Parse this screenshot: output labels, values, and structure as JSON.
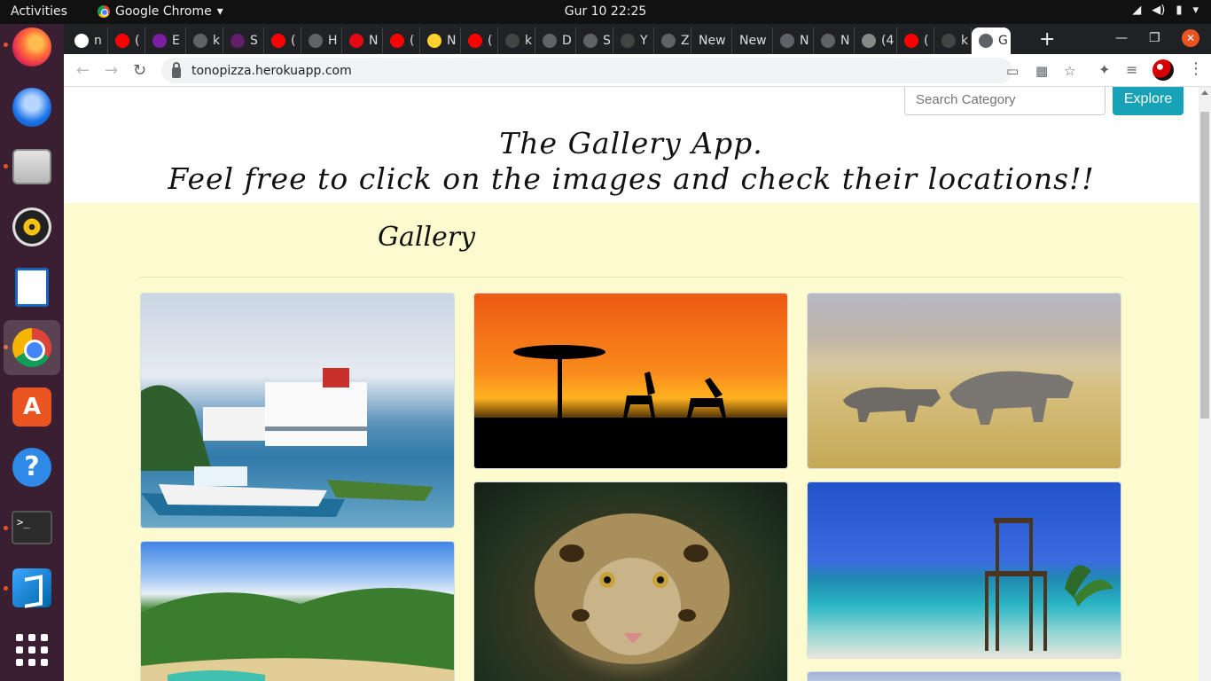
{
  "os": {
    "activities": "Activities",
    "app_menu": "Google Chrome",
    "clock": "Gur 10  22:25"
  },
  "browser": {
    "tabs": [
      {
        "label": "n",
        "icon": "google-icon"
      },
      {
        "label": "(",
        "icon": "youtube-icon"
      },
      {
        "label": "E",
        "icon": "extension-icon"
      },
      {
        "label": "k",
        "icon": "site-icon"
      },
      {
        "label": "S",
        "icon": "slack-icon"
      },
      {
        "label": "(",
        "icon": "youtube-icon"
      },
      {
        "label": "H",
        "icon": "site-icon"
      },
      {
        "label": "N",
        "icon": "netflix-icon"
      },
      {
        "label": "(",
        "icon": "youtube-icon"
      },
      {
        "label": "N",
        "icon": "miro-icon"
      },
      {
        "label": "(",
        "icon": "youtube-icon"
      },
      {
        "label": "k",
        "icon": "github-icon"
      },
      {
        "label": "D",
        "icon": "site-icon"
      },
      {
        "label": "S",
        "icon": "site-icon"
      },
      {
        "label": "Y",
        "icon": "github-icon"
      },
      {
        "label": "Z",
        "icon": "site-icon"
      },
      {
        "label": "New",
        "icon": ""
      },
      {
        "label": "New",
        "icon": ""
      },
      {
        "label": "N",
        "icon": "site-icon"
      },
      {
        "label": "N",
        "icon": "site-icon"
      },
      {
        "label": "(4",
        "icon": "audio-icon"
      },
      {
        "label": "(",
        "icon": "youtube-icon"
      },
      {
        "label": "k",
        "icon": "github-icon"
      },
      {
        "label": "G",
        "icon": "site-icon"
      }
    ],
    "url": "tonopizza.herokuapp.com"
  },
  "page": {
    "search_placeholder": "Search Category",
    "explore_label": "Explore",
    "title_line1": "The Gallery App.",
    "title_line2": "Feel free to click on the images and check their locations!!",
    "gallery_heading": "Gallery",
    "images": [
      {
        "scene": "cruise-ships-and-boats"
      },
      {
        "scene": "giraffes-at-sunset"
      },
      {
        "scene": "rhinos-on-savanna"
      },
      {
        "scene": "tropical-beach-cove"
      },
      {
        "scene": "clouded-leopard"
      },
      {
        "scene": "chair-on-beach"
      },
      {
        "scene": "sky-partial"
      }
    ]
  },
  "colors": {
    "gallery_bg": "#fbfbcd",
    "explore_button": "#17a2b8",
    "tab_strip": "#202124",
    "dock": "#3a1f33"
  }
}
